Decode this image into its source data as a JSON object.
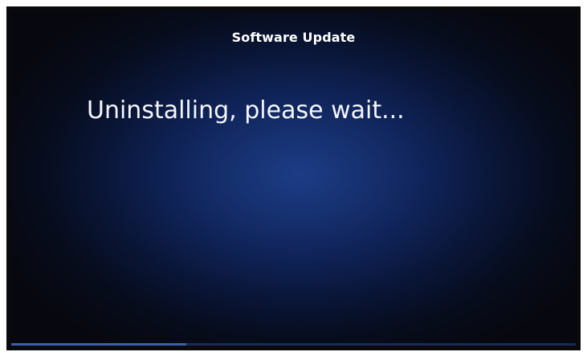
{
  "screen": {
    "title": "Software Update",
    "status_message": "Uninstalling, please wait..."
  },
  "progress": {
    "value_fraction": 0.31
  },
  "colors": {
    "background_center": "#1c3c86",
    "background_edge": "#07080f",
    "text": "#ffffff",
    "progress_fill": "#3c5fa8"
  }
}
